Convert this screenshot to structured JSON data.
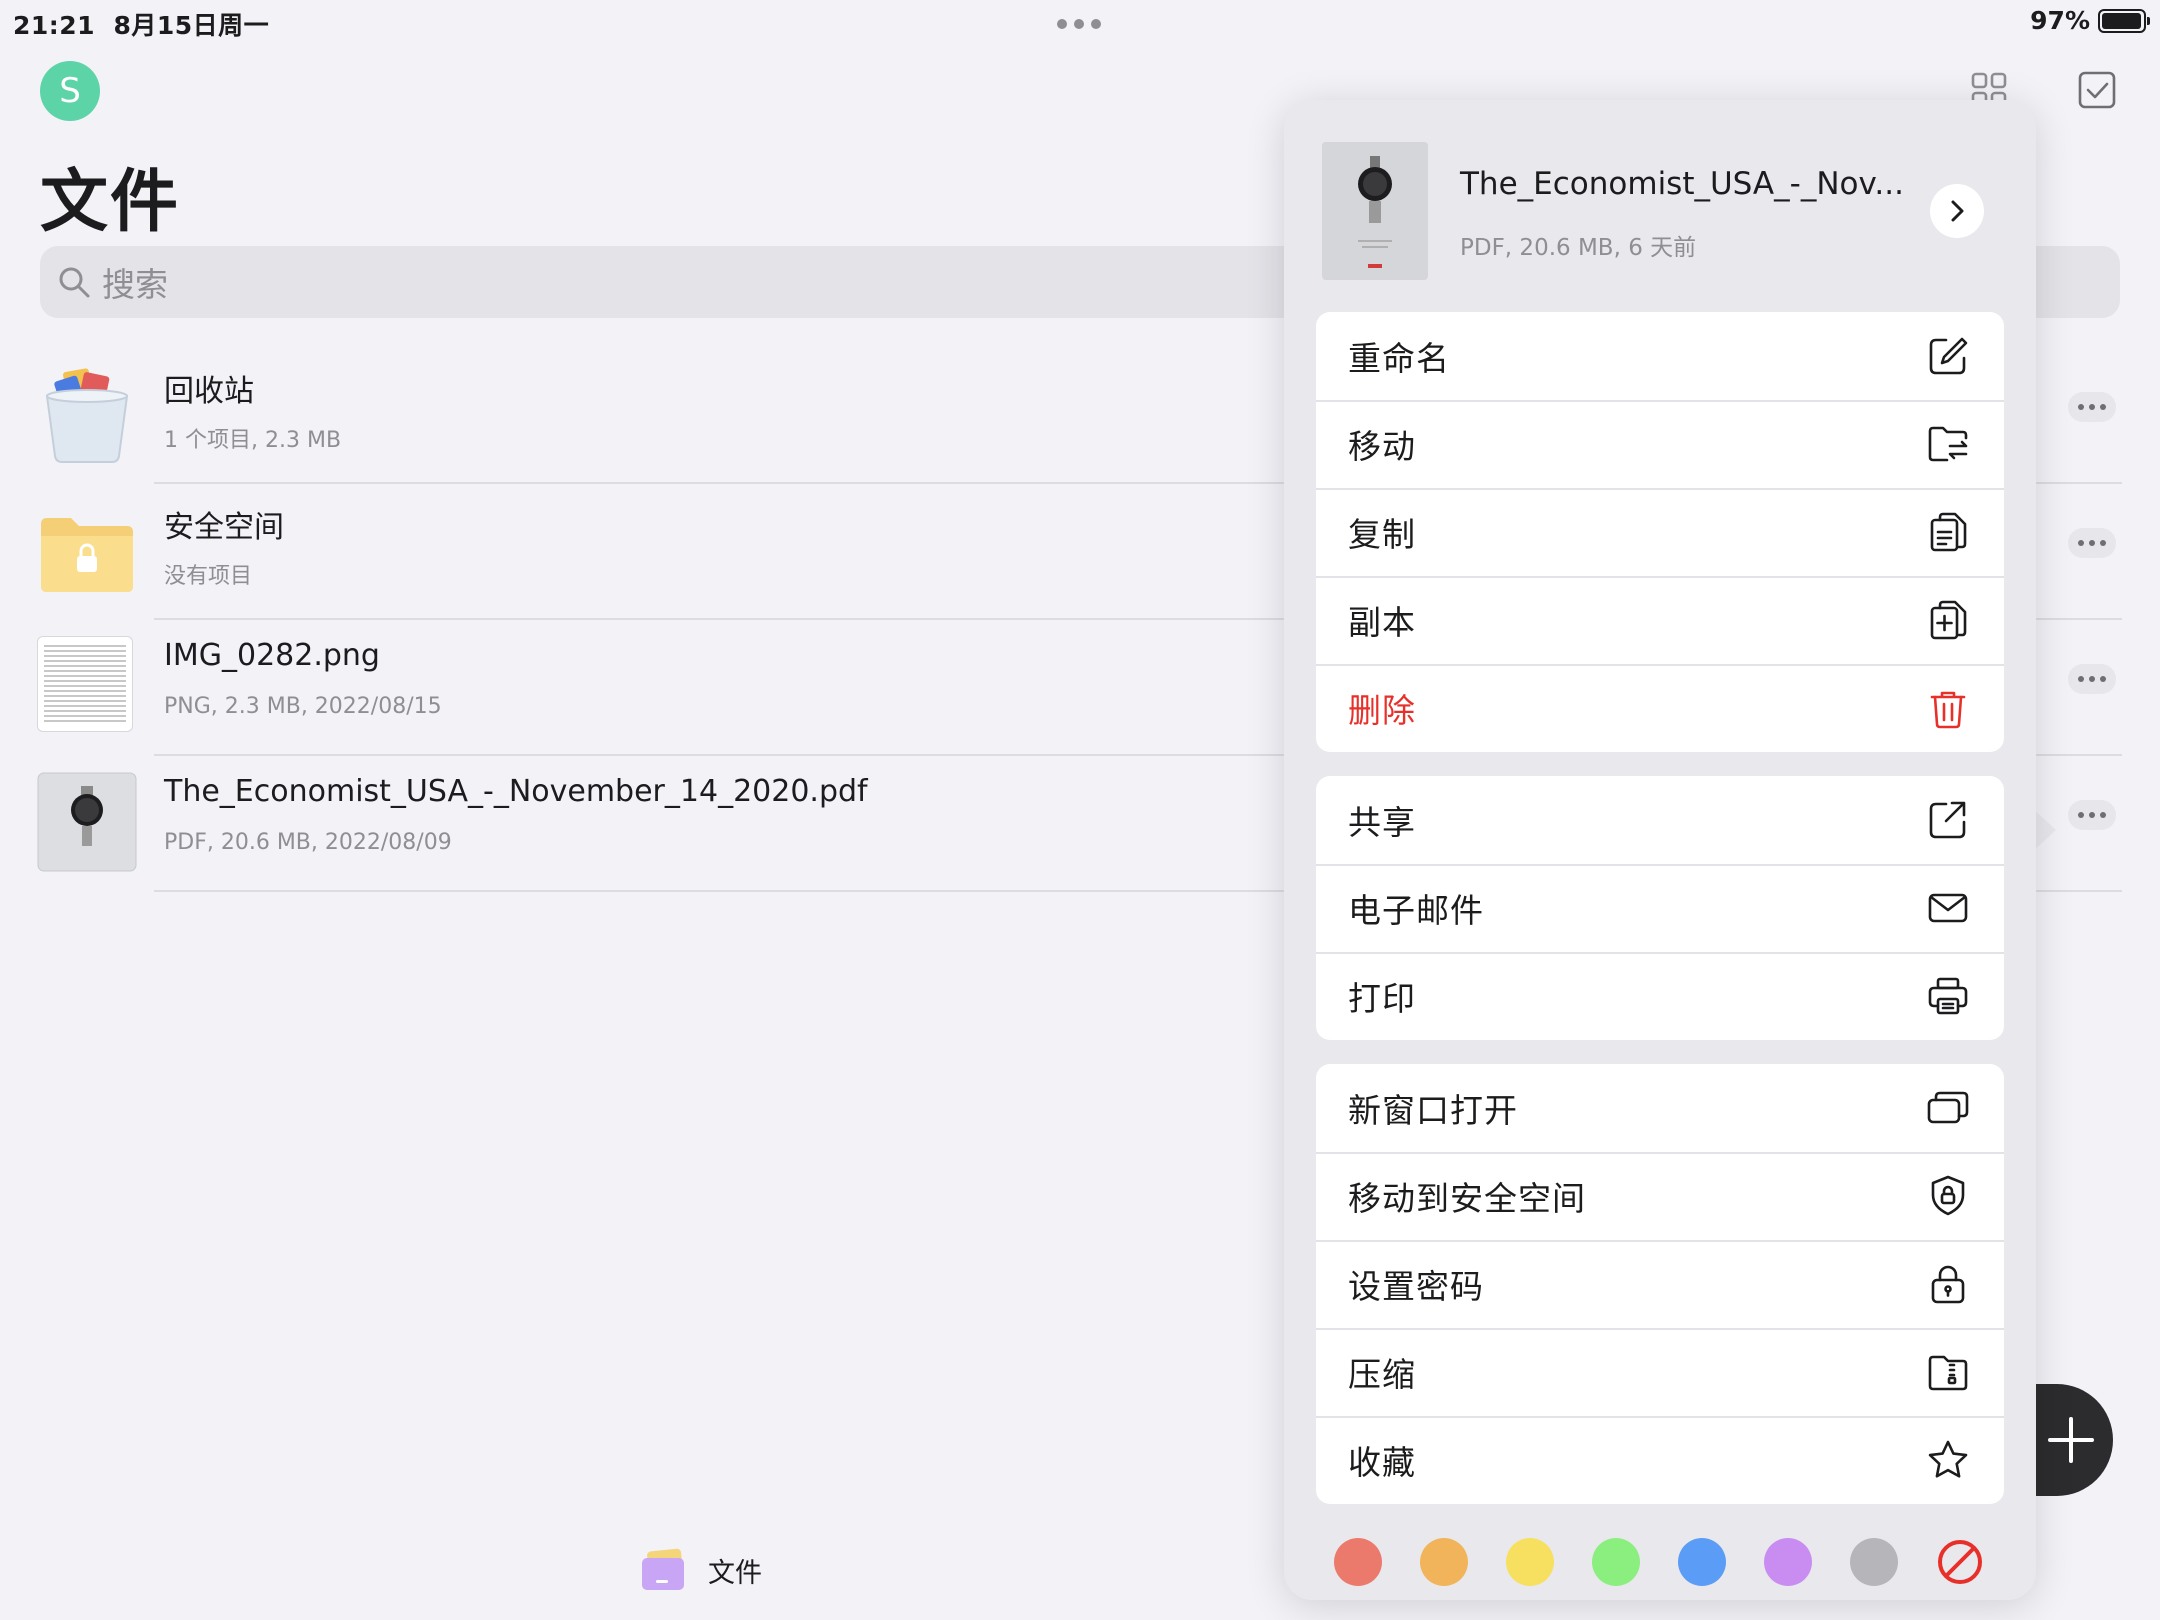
{
  "status": {
    "time": "21:21",
    "date": "8月15日周一",
    "battery": "97%",
    "battery_level": 0.97
  },
  "header": {
    "avatar_letter": "S",
    "title": "文件"
  },
  "search": {
    "placeholder": "搜索"
  },
  "files": [
    {
      "name": "回收站",
      "meta": "1 个项目, 2.3 MB",
      "icon": "trash-bin-icon"
    },
    {
      "name": "安全空间",
      "meta": "没有项目",
      "icon": "locked-folder-icon"
    },
    {
      "name": "IMG_0282.png",
      "meta": "PNG, 2.3 MB, 2022/08/15",
      "icon": "image-thumbnail"
    },
    {
      "name": "The_Economist_USA_-_November_14_2020.pdf",
      "meta": "PDF, 20.6 MB, 2022/08/09",
      "icon": "pdf-thumbnail"
    }
  ],
  "tabbar": {
    "label": "文件"
  },
  "popover": {
    "title": "The_Economist_USA_-_Nov...",
    "subtitle": "PDF, 20.6 MB, 6 天前",
    "groups": [
      [
        {
          "label": "重命名",
          "icon": "rename-icon"
        },
        {
          "label": "移动",
          "icon": "move-folder-icon"
        },
        {
          "label": "复制",
          "icon": "copy-icon"
        },
        {
          "label": "副本",
          "icon": "duplicate-icon"
        },
        {
          "label": "删除",
          "icon": "trash-icon",
          "destructive": true
        }
      ],
      [
        {
          "label": "共享",
          "icon": "share-icon"
        },
        {
          "label": "电子邮件",
          "icon": "mail-icon"
        },
        {
          "label": "打印",
          "icon": "printer-icon"
        }
      ],
      [
        {
          "label": "新窗口打开",
          "icon": "new-window-icon"
        },
        {
          "label": "移动到安全空间",
          "icon": "shield-lock-icon"
        },
        {
          "label": "设置密码",
          "icon": "padlock-icon"
        },
        {
          "label": "压缩",
          "icon": "zip-folder-icon"
        },
        {
          "label": "收藏",
          "icon": "star-icon"
        }
      ]
    ],
    "tag_colors": [
      "#ec7a6c",
      "#f2b45a",
      "#f7e05f",
      "#8aef7e",
      "#5b9cf6",
      "#c98df2",
      "#b5b5ba"
    ],
    "clear_tag_color": "#e8302a"
  }
}
